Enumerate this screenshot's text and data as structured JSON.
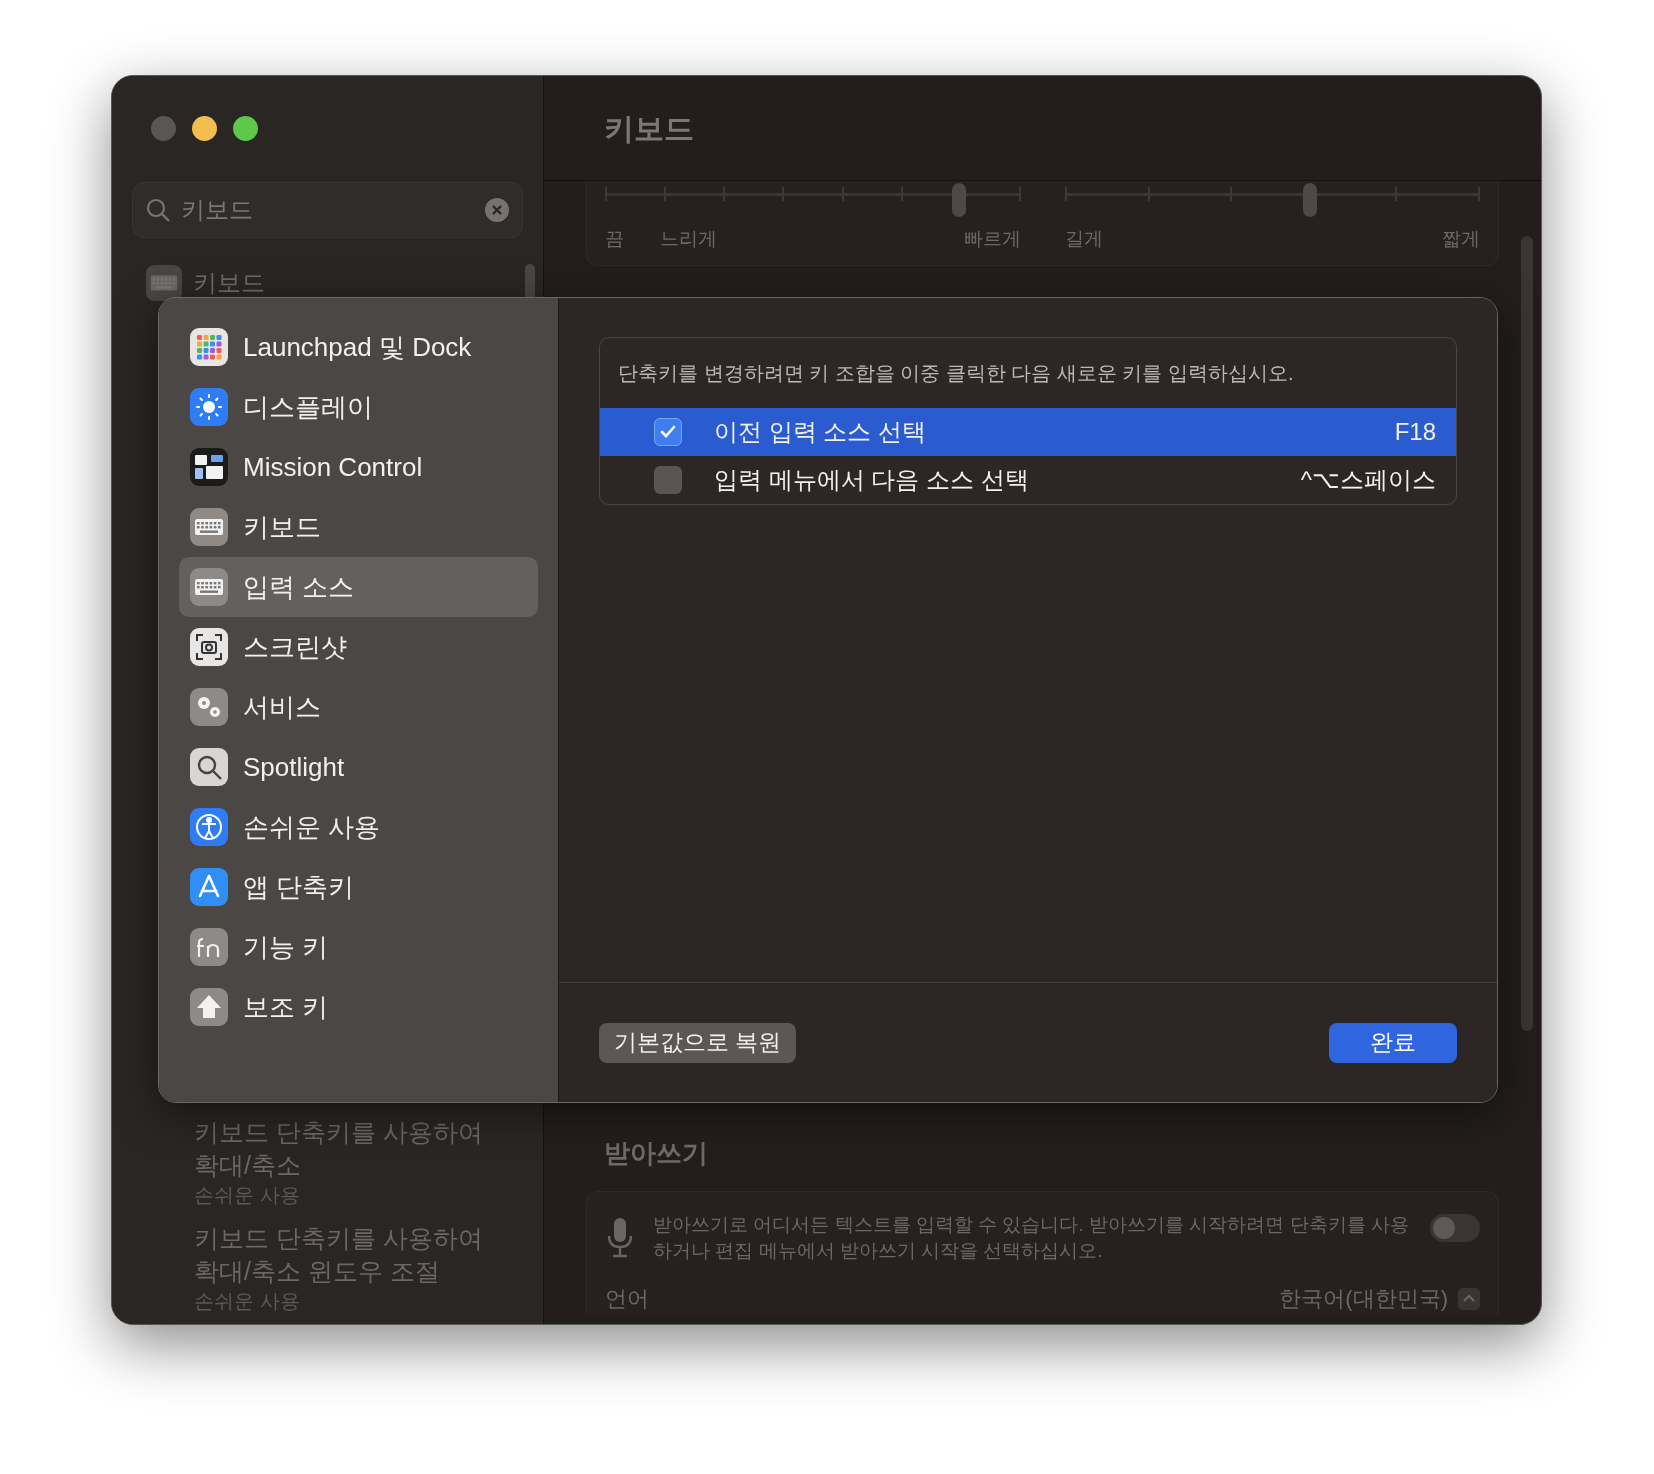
{
  "window": {
    "title": "키보드"
  },
  "search": {
    "value": "키보드"
  },
  "sidebar": {
    "items": [
      {
        "label": "키보드"
      }
    ]
  },
  "search_results": [
    {
      "title_lines": [
        "키보드 단축키를 사용하여",
        "확대/축소"
      ],
      "subtitle": "손쉬운 사용"
    },
    {
      "title_lines": [
        "키보드 단축키를 사용하여",
        "확대/축소 윈도우 조절"
      ],
      "subtitle": "손쉬운 사용"
    }
  ],
  "sliders": [
    {
      "level": 0.85,
      "labels": [
        "끔",
        "느리게",
        "빠르게"
      ]
    },
    {
      "level": 0.59,
      "labels": [
        "길게",
        "짧게"
      ]
    }
  ],
  "dictation": {
    "heading": "받아쓰기",
    "description": "받아쓰기로 어디서든 텍스트를 입력할 수 있습니다. 받아쓰기를 시작하려면 단축키를 사용하거나 편집 메뉴에서 받아쓰기 시작을 선택하십시오.",
    "on": false,
    "language_label": "언어",
    "language_value": "한국어(대한민국)"
  },
  "dialog": {
    "categories": [
      {
        "label": "Launchpad 및 Dock",
        "selected": false
      },
      {
        "label": "디스플레이",
        "selected": false
      },
      {
        "label": "Mission Control",
        "selected": false
      },
      {
        "label": "키보드",
        "selected": false
      },
      {
        "label": "입력 소스",
        "selected": true
      },
      {
        "label": "스크린샷",
        "selected": false
      },
      {
        "label": "서비스",
        "selected": false
      },
      {
        "label": "Spotlight",
        "selected": false
      },
      {
        "label": "손쉬운 사용",
        "selected": false
      },
      {
        "label": "앱 단축키",
        "selected": false
      },
      {
        "label": "기능 키",
        "selected": false
      },
      {
        "label": "보조 키",
        "selected": false
      }
    ],
    "hint": "단축키를 변경하려면 키 조합을 이중 클릭한 다음 새로운 키를 입력하십시오.",
    "shortcuts": [
      {
        "label": "이전 입력 소스 선택",
        "keys": "F18",
        "checked": true,
        "selected": true
      },
      {
        "label": "입력 메뉴에서 다음 소스 선택",
        "keys": "^⌥스페이스",
        "checked": false,
        "selected": false
      }
    ],
    "buttons": {
      "restore": "기본값으로 복원",
      "done": "완료"
    }
  }
}
